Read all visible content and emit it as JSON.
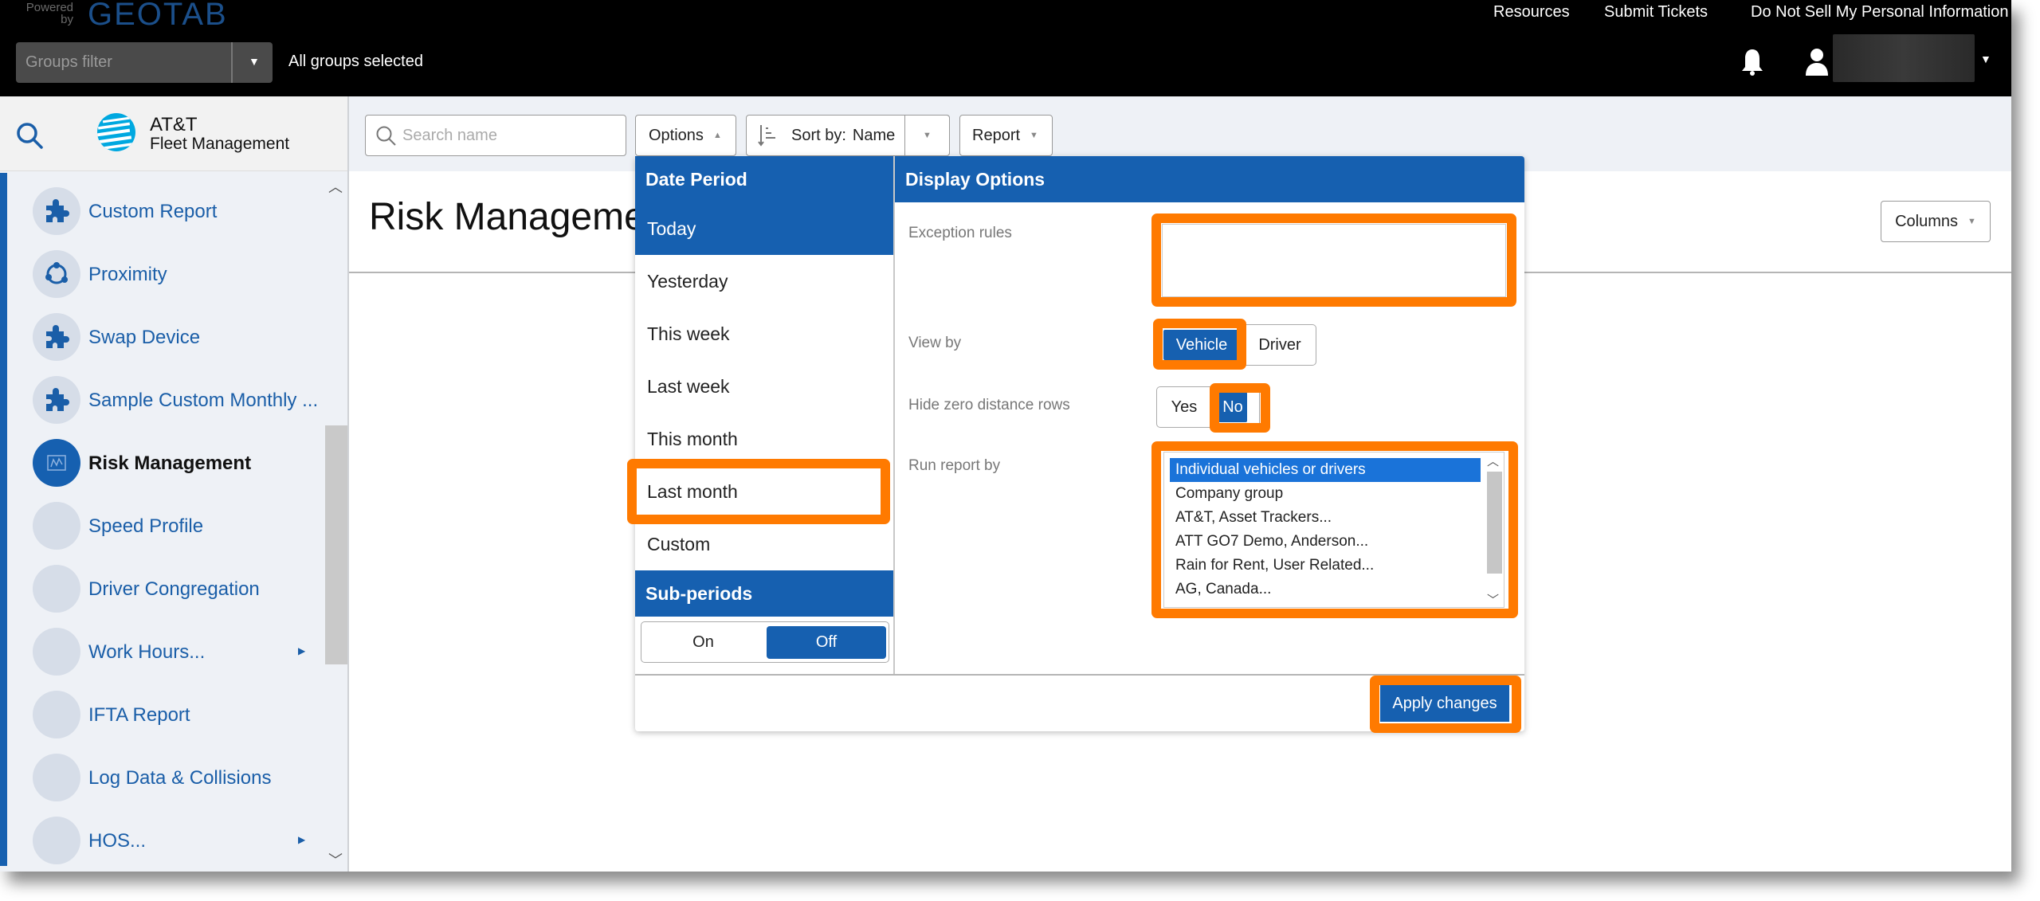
{
  "header": {
    "powered_by": "Powered by",
    "brand": "GEOTAB",
    "groups_filter_placeholder": "Groups filter",
    "groups_status": "All groups selected",
    "links": [
      "Resources",
      "Submit Tickets",
      "Do Not Sell My Personal Information"
    ],
    "user_name": ""
  },
  "sidebar": {
    "logo_title": "AT&T",
    "logo_subtitle": "Fleet Management",
    "items": [
      {
        "label": "Custom Report",
        "icon": "puzzle-icon"
      },
      {
        "label": "Proximity",
        "icon": "proximity-icon"
      },
      {
        "label": "Swap Device",
        "icon": "puzzle-icon"
      },
      {
        "label": "Sample Custom Monthly ...",
        "icon": "puzzle-icon"
      },
      {
        "label": "Risk Management",
        "icon": "risk-chart-icon",
        "active": true
      },
      {
        "label": "Speed Profile",
        "icon": ""
      },
      {
        "label": "Driver Congregation",
        "icon": ""
      },
      {
        "label": "Work Hours...",
        "icon": "",
        "submenu": true
      },
      {
        "label": "IFTA Report",
        "icon": ""
      },
      {
        "label": "Log Data & Collisions",
        "icon": ""
      },
      {
        "label": "HOS...",
        "icon": "",
        "submenu": true
      }
    ]
  },
  "toolbar": {
    "search_placeholder": "Search name",
    "options_label": "Options",
    "sort_prefix": "Sort by:",
    "sort_value": "Name",
    "report_label": "Report"
  },
  "page": {
    "title": "Risk Management",
    "columns_label": "Columns"
  },
  "options_panel": {
    "date_period": {
      "heading": "Date Period",
      "items": [
        "Today",
        "Yesterday",
        "This week",
        "Last week",
        "This month",
        "Last month",
        "Custom"
      ],
      "selected": "Today",
      "highlighted": "Last month"
    },
    "sub_periods": {
      "heading": "Sub-periods",
      "on_label": "On",
      "off_label": "Off",
      "selected": "Off"
    },
    "display_options": {
      "heading": "Display Options",
      "exception_rules_label": "Exception rules",
      "exception_rules_value": "",
      "view_by_label": "View by",
      "view_by_options": [
        "Vehicle",
        "Driver"
      ],
      "view_by_selected": "Vehicle",
      "hide_zero_label": "Hide zero distance rows",
      "hide_zero_options": [
        "Yes",
        "No"
      ],
      "hide_zero_selected": "No",
      "run_report_label": "Run report by",
      "run_report_options": [
        "Individual vehicles or drivers",
        "Company group",
        "AT&T, Asset Trackers...",
        "ATT GO7 Demo, Anderson...",
        "Rain for Rent, User Related...",
        "AG, Canada..."
      ],
      "run_report_selected": "Individual vehicles or drivers"
    },
    "apply_label": "Apply changes"
  },
  "colors": {
    "primary": "#1660b0",
    "highlight": "#ff7a00",
    "header_bg": "#000000",
    "sidebar_bg": "#eef1f6"
  }
}
